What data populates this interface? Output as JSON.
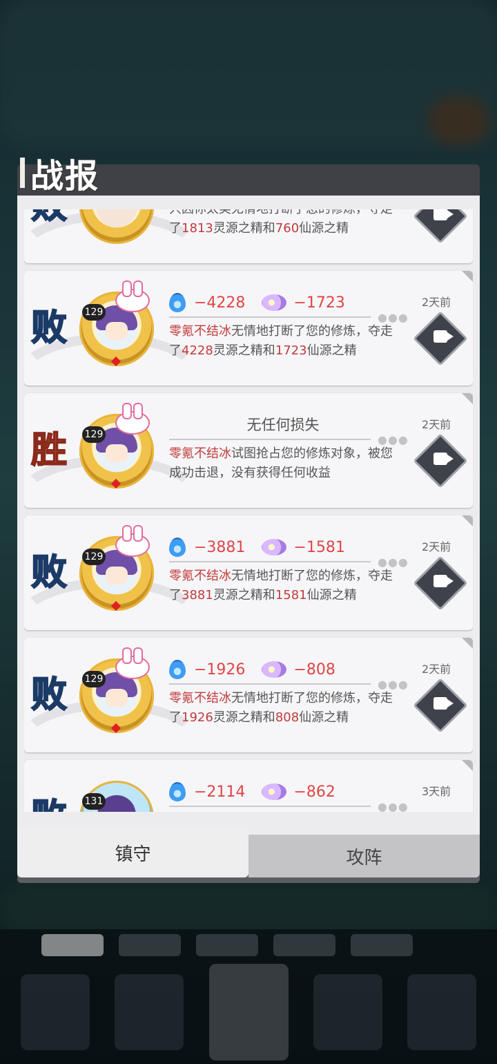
{
  "panel": {
    "title": "战报"
  },
  "reports": [
    {
      "result": "败",
      "level": "",
      "spirit_loss": "",
      "immortal_loss": "",
      "no_loss_text": "",
      "desc_name": "",
      "desc_pre": "只因你太美无情地打断了您的修炼，夺走了",
      "desc_num1": "1813",
      "desc_mid": "灵源之精和",
      "desc_num2": "760",
      "desc_post": "仙源之精",
      "time": ""
    },
    {
      "result": "败",
      "level": "129",
      "spirit_loss": "−4228",
      "immortal_loss": "−1723",
      "desc_name": "零氪不结冰",
      "desc_pre": "无情地打断了您的修炼，夺走了",
      "desc_num1": "4228",
      "desc_mid": "灵源之精和",
      "desc_num2": "1723",
      "desc_post": "仙源之精",
      "time": "2天前"
    },
    {
      "result": "胜",
      "level": "129",
      "no_loss_text": "无任何损失",
      "desc_name": "零氪不结冰",
      "desc_pre": "试图抢占您的修炼对象，被您成功击退，没有获得任何收益",
      "time": "2天前"
    },
    {
      "result": "败",
      "level": "129",
      "spirit_loss": "−3881",
      "immortal_loss": "−1581",
      "desc_name": "零氪不结冰",
      "desc_pre": "无情地打断了您的修炼，夺走了",
      "desc_num1": "3881",
      "desc_mid": "灵源之精和",
      "desc_num2": "1581",
      "desc_post": "仙源之精",
      "time": "2天前"
    },
    {
      "result": "败",
      "level": "129",
      "spirit_loss": "−1926",
      "immortal_loss": "−808",
      "desc_name": "零氪不结冰",
      "desc_pre": "无情地打断了您的修炼，夺走了",
      "desc_num1": "1926",
      "desc_mid": "灵源之精和",
      "desc_num2": "808",
      "desc_post": "仙源之精",
      "time": "2天前"
    },
    {
      "result": "败",
      "level": "131",
      "spirit_loss": "−2114",
      "immortal_loss": "−862",
      "time": "3天前"
    }
  ],
  "tabs": {
    "defend": "镇守",
    "attack": "攻阵"
  },
  "icons": {
    "spirit": "blue-flame-icon",
    "immortal": "purple-crystal-icon",
    "replay": "video-replay-icon"
  },
  "colors": {
    "loss_red": "#e04545",
    "lose_blue": "#5a9ee6",
    "win_peach": "#f3c5a8"
  }
}
